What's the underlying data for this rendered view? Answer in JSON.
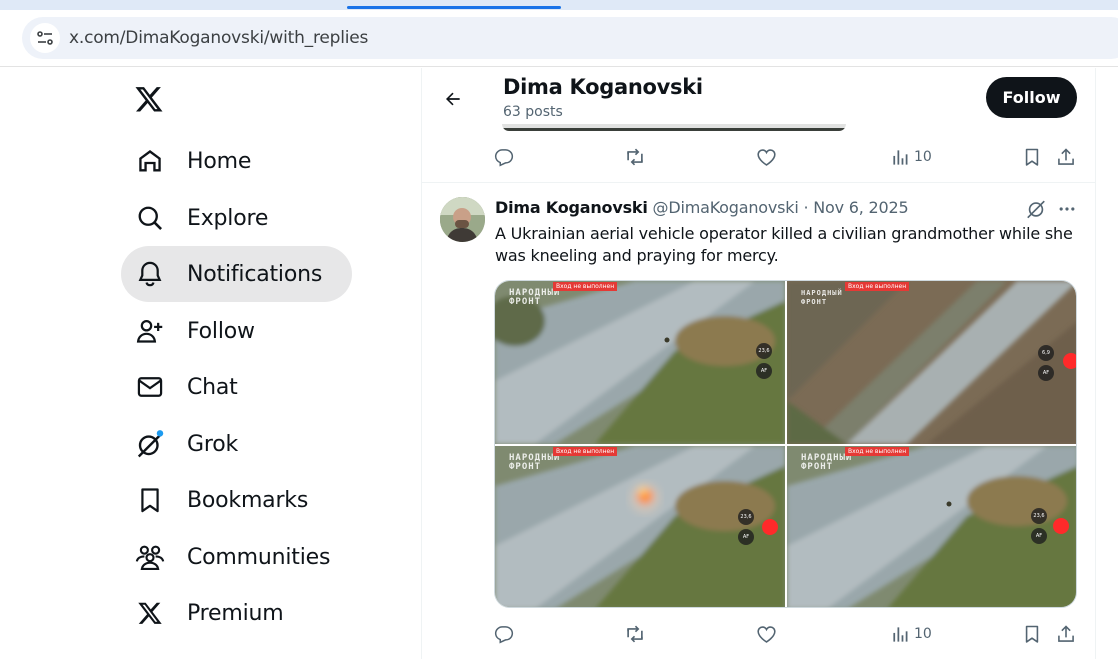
{
  "browser": {
    "url": "x.com/DimaKoganovski/with_replies"
  },
  "sidebar": {
    "logo": "x-logo-icon",
    "items": [
      {
        "label": "Home",
        "icon": "home-icon"
      },
      {
        "label": "Explore",
        "icon": "search-icon"
      },
      {
        "label": "Notifications",
        "icon": "bell-icon",
        "active": true
      },
      {
        "label": "Follow",
        "icon": "person-add-icon"
      },
      {
        "label": "Chat",
        "icon": "mail-icon"
      },
      {
        "label": "Grok",
        "icon": "grok-icon"
      },
      {
        "label": "Bookmarks",
        "icon": "bookmark-icon"
      },
      {
        "label": "Communities",
        "icon": "communities-icon"
      },
      {
        "label": "Premium",
        "icon": "x-premium-icon"
      }
    ]
  },
  "header": {
    "name": "Dima Koganovski",
    "posts": "63 posts",
    "follow_label": "Follow"
  },
  "prev_post": {
    "views": "10"
  },
  "post": {
    "name": "Dima Koganovski",
    "handle": "@DimaKoganovski",
    "dot": "·",
    "date": "Nov 6, 2025",
    "text": "A Ukrainian aerial vehicle operator killed a civilian grandmother while she was kneeling and praying for mercy.",
    "views": "10",
    "media": {
      "watermark_line1": "НАРОДНЫЙ",
      "watermark_line2": "ФРОНТ",
      "tag": "Вход не выполнен",
      "hud_top": "23,6",
      "hud_af": "AF",
      "hud_top_2": "6,9"
    }
  },
  "colors": {
    "accent": "#1d9bf0",
    "text_primary": "#0f1419",
    "text_secondary": "#536471",
    "follow_bg": "#0f1419",
    "active_nav_bg": "#e7e7e8"
  }
}
